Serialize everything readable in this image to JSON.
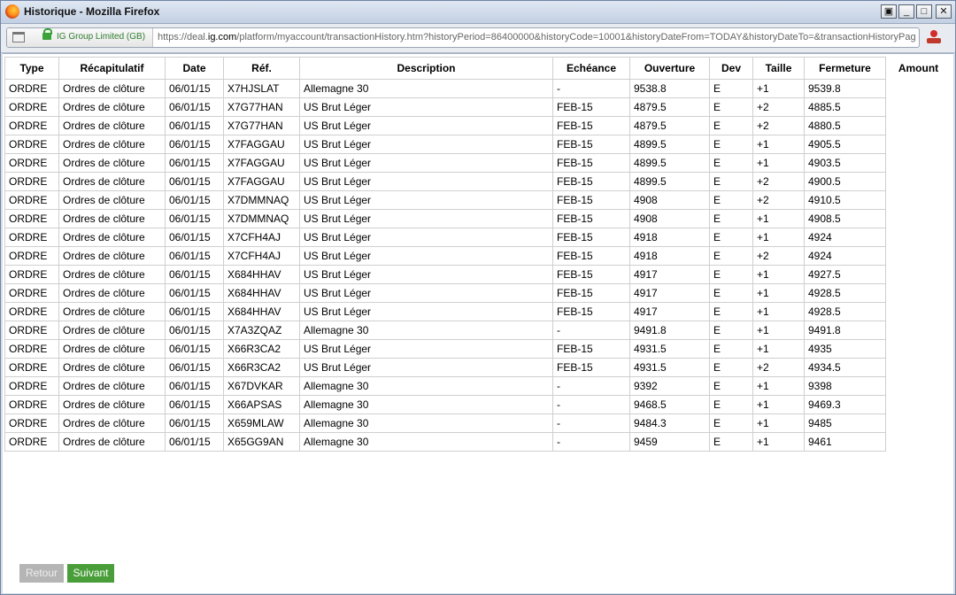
{
  "window": {
    "title": "Historique - Mozilla Firefox",
    "buttons": {
      "restore_alt": "▣",
      "minimize": "_",
      "maximize": "□",
      "close": "✕"
    }
  },
  "urlbar": {
    "site_identity": "IG Group Limited (GB)",
    "url_prefix": "https://deal.",
    "url_domain": "ig.com",
    "url_rest": "/platform/myaccount/transactionHistory.htm?historyPeriod=86400000&historyCode=10001&historyDateFrom=TODAY&historyDateTo=&transactionHistoryPag",
    "icons": {
      "page": "page-icon",
      "lock": "lock-icon",
      "addon": "addon-icon"
    }
  },
  "table": {
    "headers": [
      "Type",
      "Récapitulatif",
      "Date",
      "Réf.",
      "Description",
      "Echéance",
      "Ouverture",
      "Dev",
      "Taille",
      "Fermeture",
      "Amount"
    ],
    "rows": [
      [
        "ORDRE",
        "Ordres de clôture",
        "06/01/15",
        "X7HJSLAT",
        "Allemagne 30",
        "-",
        "9538.8",
        "E",
        "+1",
        "9539.8"
      ],
      [
        "ORDRE",
        "Ordres de clôture",
        "06/01/15",
        "X7G77HAN",
        "US Brut Léger",
        "FEB-15",
        "4879.5",
        "E",
        "+2",
        "4885.5"
      ],
      [
        "ORDRE",
        "Ordres de clôture",
        "06/01/15",
        "X7G77HAN",
        "US Brut Léger",
        "FEB-15",
        "4879.5",
        "E",
        "+2",
        "4880.5"
      ],
      [
        "ORDRE",
        "Ordres de clôture",
        "06/01/15",
        "X7FAGGAU",
        "US Brut Léger",
        "FEB-15",
        "4899.5",
        "E",
        "+1",
        "4905.5"
      ],
      [
        "ORDRE",
        "Ordres de clôture",
        "06/01/15",
        "X7FAGGAU",
        "US Brut Léger",
        "FEB-15",
        "4899.5",
        "E",
        "+1",
        "4903.5"
      ],
      [
        "ORDRE",
        "Ordres de clôture",
        "06/01/15",
        "X7FAGGAU",
        "US Brut Léger",
        "FEB-15",
        "4899.5",
        "E",
        "+2",
        "4900.5"
      ],
      [
        "ORDRE",
        "Ordres de clôture",
        "06/01/15",
        "X7DMMNAQ",
        "US Brut Léger",
        "FEB-15",
        "4908",
        "E",
        "+2",
        "4910.5"
      ],
      [
        "ORDRE",
        "Ordres de clôture",
        "06/01/15",
        "X7DMMNAQ",
        "US Brut Léger",
        "FEB-15",
        "4908",
        "E",
        "+1",
        "4908.5"
      ],
      [
        "ORDRE",
        "Ordres de clôture",
        "06/01/15",
        "X7CFH4AJ",
        "US Brut Léger",
        "FEB-15",
        "4918",
        "E",
        "+1",
        "4924"
      ],
      [
        "ORDRE",
        "Ordres de clôture",
        "06/01/15",
        "X7CFH4AJ",
        "US Brut Léger",
        "FEB-15",
        "4918",
        "E",
        "+2",
        "4924"
      ],
      [
        "ORDRE",
        "Ordres de clôture",
        "06/01/15",
        "X684HHAV",
        "US Brut Léger",
        "FEB-15",
        "4917",
        "E",
        "+1",
        "4927.5"
      ],
      [
        "ORDRE",
        "Ordres de clôture",
        "06/01/15",
        "X684HHAV",
        "US Brut Léger",
        "FEB-15",
        "4917",
        "E",
        "+1",
        "4928.5"
      ],
      [
        "ORDRE",
        "Ordres de clôture",
        "06/01/15",
        "X684HHAV",
        "US Brut Léger",
        "FEB-15",
        "4917",
        "E",
        "+1",
        "4928.5"
      ],
      [
        "ORDRE",
        "Ordres de clôture",
        "06/01/15",
        "X7A3ZQAZ",
        "Allemagne 30",
        "-",
        "9491.8",
        "E",
        "+1",
        "9491.8"
      ],
      [
        "ORDRE",
        "Ordres de clôture",
        "06/01/15",
        "X66R3CA2",
        "US Brut Léger",
        "FEB-15",
        "4931.5",
        "E",
        "+1",
        "4935"
      ],
      [
        "ORDRE",
        "Ordres de clôture",
        "06/01/15",
        "X66R3CA2",
        "US Brut Léger",
        "FEB-15",
        "4931.5",
        "E",
        "+2",
        "4934.5"
      ],
      [
        "ORDRE",
        "Ordres de clôture",
        "06/01/15",
        "X67DVKAR",
        "Allemagne 30",
        "-",
        "9392",
        "E",
        "+1",
        "9398"
      ],
      [
        "ORDRE",
        "Ordres de clôture",
        "06/01/15",
        "X66APSAS",
        "Allemagne 30",
        "-",
        "9468.5",
        "E",
        "+1",
        "9469.3"
      ],
      [
        "ORDRE",
        "Ordres de clôture",
        "06/01/15",
        "X659MLAW",
        "Allemagne 30",
        "-",
        "9484.3",
        "E",
        "+1",
        "9485"
      ],
      [
        "ORDRE",
        "Ordres de clôture",
        "06/01/15",
        "X65GG9AN",
        "Allemagne 30",
        "-",
        "9459",
        "E",
        "+1",
        "9461"
      ]
    ]
  },
  "footer": {
    "prev_label": "Retour",
    "next_label": "Suivant"
  },
  "colors": {
    "next_button": "#4a9e3a",
    "prev_button_disabled": "#b5b5b5",
    "secure_identity": "#2e7d2e"
  }
}
